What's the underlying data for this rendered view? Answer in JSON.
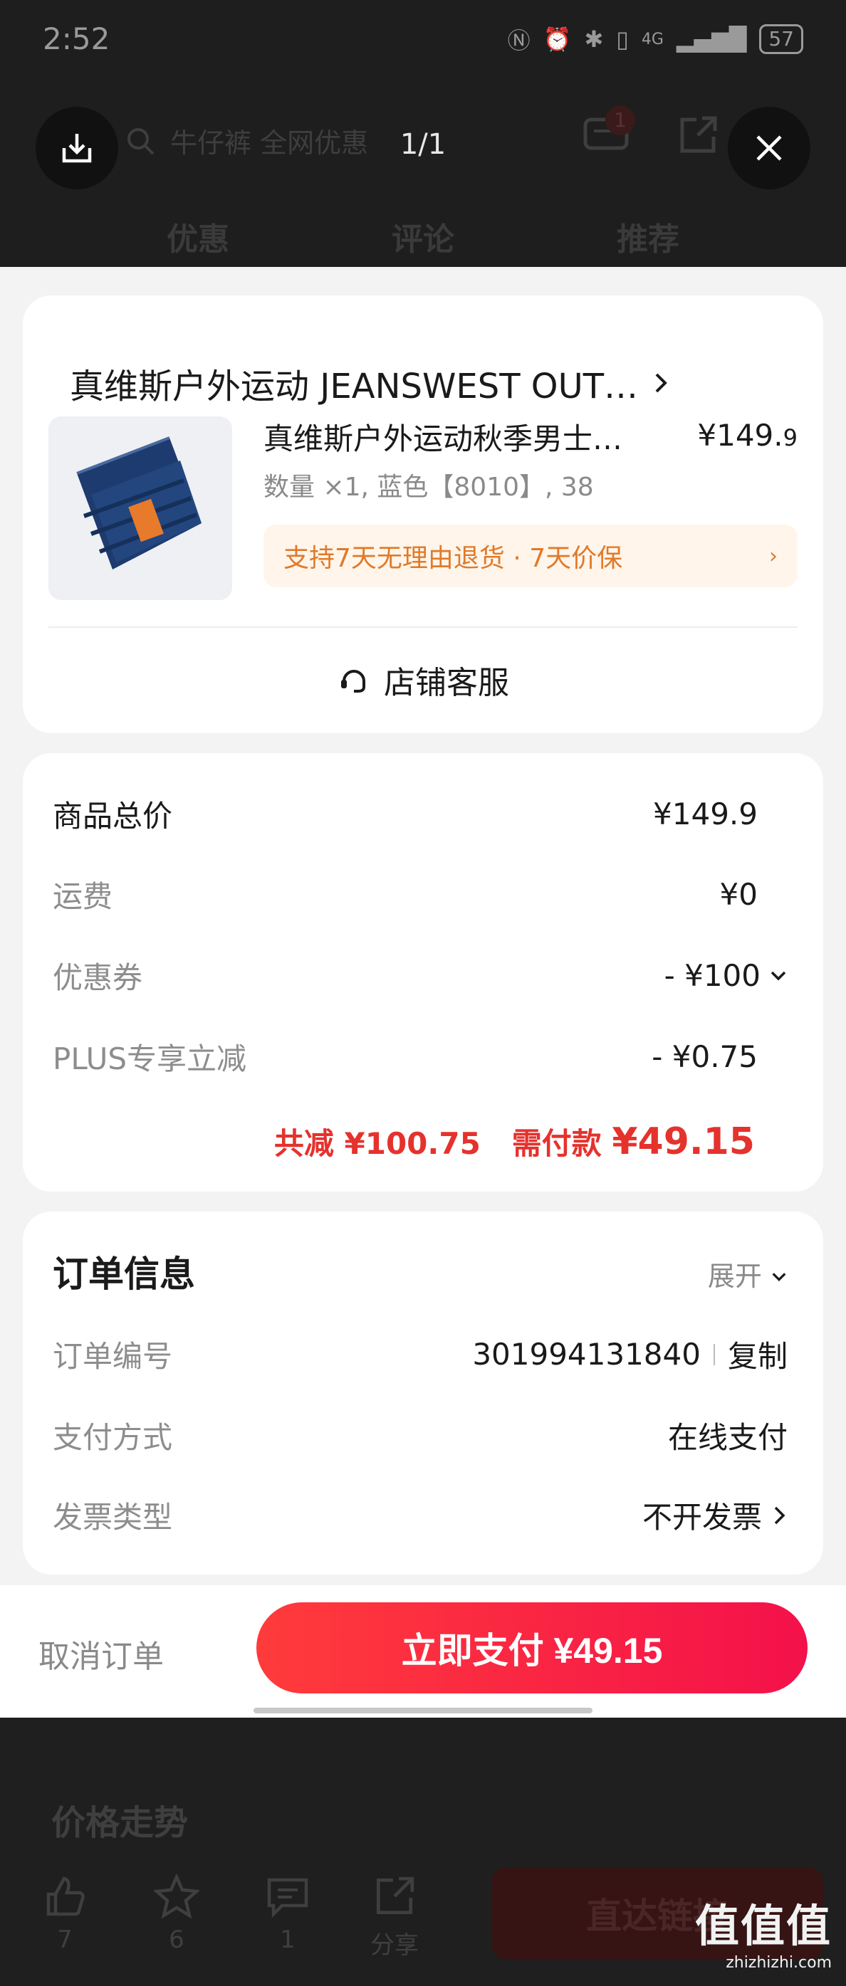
{
  "status_bar": {
    "time": "2:52",
    "network": "4G",
    "battery": "57"
  },
  "background": {
    "search_text": "牛仔裤 全网优惠",
    "cart_badge": "1",
    "tabs": [
      "优惠",
      "评论",
      "推荐"
    ],
    "price_trend": "价格走势",
    "actions": [
      {
        "count": "7"
      },
      {
        "count": "6"
      },
      {
        "count": "1"
      },
      {
        "label": "分享"
      }
    ],
    "direct_link": "直达链接",
    "watermark": {
      "brand": "值值值",
      "url": "zhizhizhi.com"
    }
  },
  "viewer": {
    "counter": "1/1"
  },
  "store": {
    "name": "真维斯户外运动 JEANSWEST OUT…",
    "product": {
      "title": "真维斯户外运动秋季男士…",
      "price_main": "¥149.",
      "price_decimal": "9",
      "spec": "数量 ×1, 蓝色【8010】, 38",
      "promise": "支持7天无理由退货 · 7天价保"
    },
    "service": "店铺客服"
  },
  "pricing": {
    "rows": [
      {
        "label": "商品总价",
        "value": "¥149.9"
      },
      {
        "label": "运费",
        "value": "¥0"
      },
      {
        "label": "优惠券",
        "value": "- ¥100"
      },
      {
        "label": "PLUS专享立减",
        "value": "- ¥0.75"
      }
    ],
    "saved_label": "共减",
    "saved_value": "¥100.75",
    "due_label": "需付款",
    "due_value": "¥49.15"
  },
  "order_info": {
    "title": "订单信息",
    "expand": "展开",
    "rows": [
      {
        "label": "订单编号",
        "value": "301994131840",
        "action": "复制"
      },
      {
        "label": "支付方式",
        "value": "在线支付"
      },
      {
        "label": "发票类型",
        "value": "不开发票"
      }
    ]
  },
  "bottom": {
    "cancel": "取消订单",
    "pay": "立即支付 ¥49.15"
  },
  "colors": {
    "accent": "#f4114a",
    "price_red": "#e5322d",
    "promise_orange": "#e07a2a"
  }
}
